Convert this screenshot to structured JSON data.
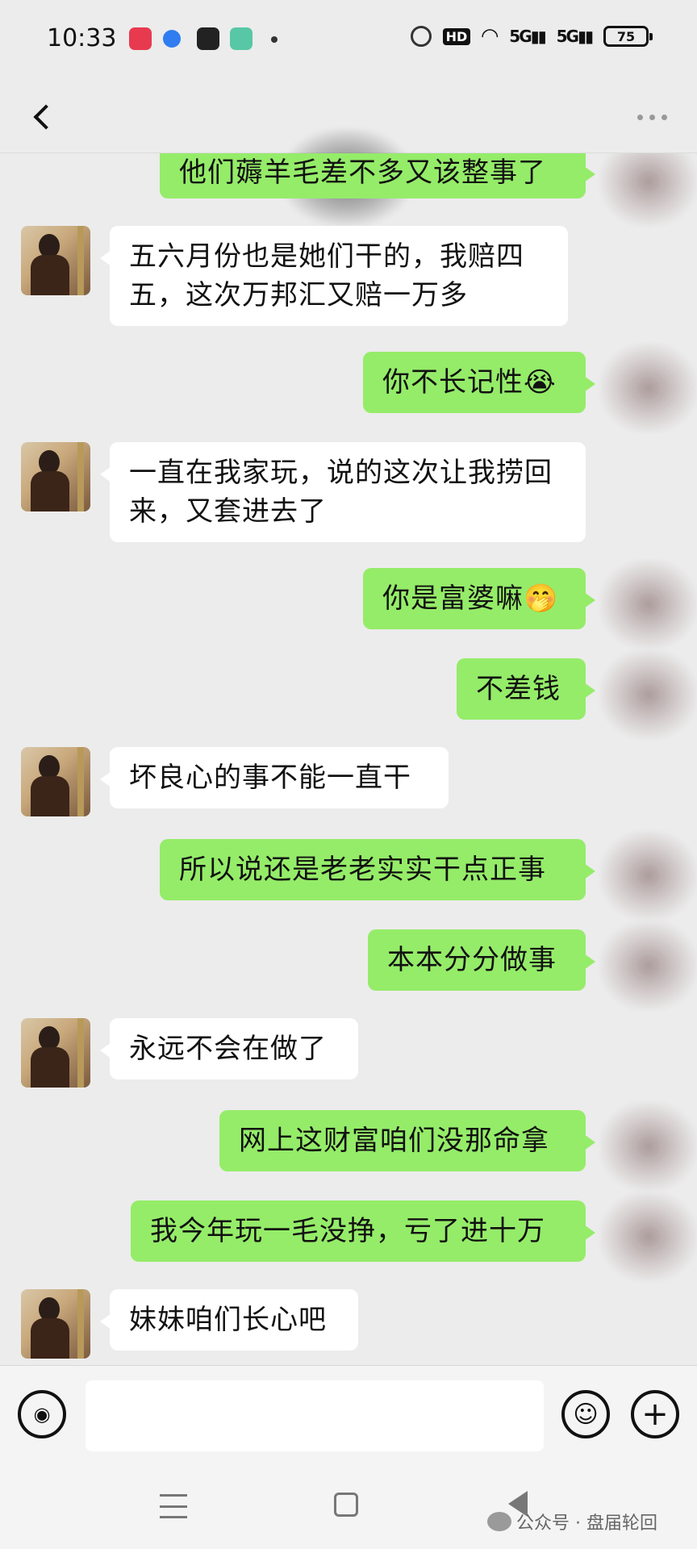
{
  "status_bar": {
    "time": "10:33",
    "hd_label": "HD",
    "signal1": "5G",
    "signal2": "5G",
    "battery": "75"
  },
  "header": {
    "back_icon": "chevron-left-icon",
    "more_icon": "more-dots-icon"
  },
  "messages": [
    {
      "side": "right",
      "text": "他们薅羊毛差不多又该整事了"
    },
    {
      "side": "left",
      "text": "五六月份也是她们干的，我赔四五，这次万邦汇又赔一万多"
    },
    {
      "side": "right",
      "text": "你不长记性😭"
    },
    {
      "side": "left",
      "text": "一直在我家玩，说的这次让我捞回来，又套进去了"
    },
    {
      "side": "right",
      "text": "你是富婆嘛🤭"
    },
    {
      "side": "right",
      "text": "不差钱"
    },
    {
      "side": "left",
      "text": "坏良心的事不能一直干"
    },
    {
      "side": "right",
      "text": "所以说还是老老实实干点正事"
    },
    {
      "side": "right",
      "text": "本本分分做事"
    },
    {
      "side": "left",
      "text": "永远不会在做了"
    },
    {
      "side": "right",
      "text": "网上这财富咱们没那命拿"
    },
    {
      "side": "right",
      "text": "我今年玩一毛没挣，亏了进十万"
    },
    {
      "side": "left",
      "text": "妹妹咱们长心吧"
    }
  ],
  "input_bar": {
    "voice_icon": "voice-icon",
    "emoji_icon": "emoji-icon",
    "plus_icon": "plus-icon",
    "text_value": ""
  },
  "watermark": {
    "text": "公众号 · 盘届轮回"
  },
  "colors": {
    "background": "#ececec",
    "sent_bubble": "#95ec69",
    "received_bubble": "#ffffff"
  }
}
